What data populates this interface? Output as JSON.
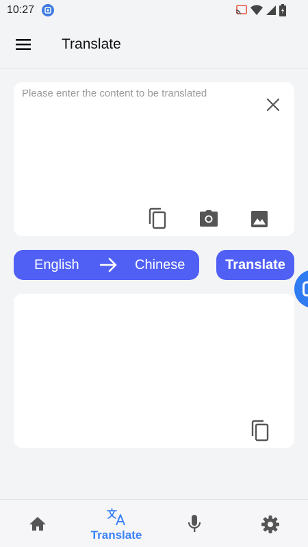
{
  "status_bar": {
    "time": "10:27",
    "icons": [
      "app-notification-icon",
      "cast-icon",
      "wifi-icon",
      "signal-icon",
      "battery-icon"
    ]
  },
  "app_bar": {
    "title": "Translate",
    "menu_icon": "hamburger-menu-icon"
  },
  "input": {
    "placeholder": "Please enter the content to be translated",
    "value": "",
    "actions": [
      "close-icon",
      "copy-icon",
      "camera-icon",
      "image-icon"
    ]
  },
  "language": {
    "source": "English",
    "target": "Chinese",
    "arrow_icon": "arrow-right-icon"
  },
  "translate_button": {
    "label": "Translate"
  },
  "output": {
    "text": "",
    "actions": [
      "copy-icon"
    ]
  },
  "bottom_nav": {
    "items": [
      {
        "icon": "home-icon",
        "label": ""
      },
      {
        "icon": "translate-icon",
        "label": "Translate",
        "active": true
      },
      {
        "icon": "microphone-icon",
        "label": ""
      },
      {
        "icon": "settings-icon",
        "label": ""
      }
    ]
  },
  "colors": {
    "accent": "#5060f5",
    "nav_active": "#3b82f6",
    "background": "#f3f4f6",
    "icon_gray": "#555555"
  }
}
